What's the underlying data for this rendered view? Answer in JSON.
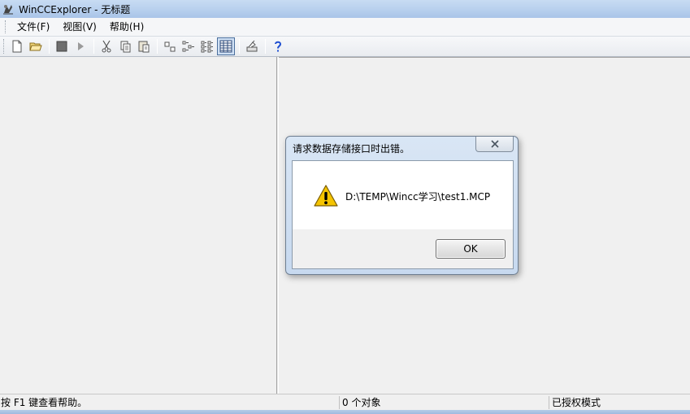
{
  "window": {
    "title": "WinCCExplorer - 无标题",
    "icon": "wincc-app-icon"
  },
  "menu": {
    "items": [
      {
        "label": "文件(F)"
      },
      {
        "label": "视图(V)"
      },
      {
        "label": "帮助(H)"
      }
    ]
  },
  "toolbar": {
    "buttons": [
      {
        "icon": "new-file-icon"
      },
      {
        "icon": "open-folder-icon"
      },
      {
        "icon": "stop-icon"
      },
      {
        "icon": "play-icon"
      },
      {
        "icon": "cut-icon"
      },
      {
        "icon": "copy-icon"
      },
      {
        "icon": "paste-icon"
      },
      {
        "icon": "large-icons-view-icon"
      },
      {
        "icon": "small-icons-view-icon"
      },
      {
        "icon": "list-view-icon"
      },
      {
        "icon": "details-view-icon"
      },
      {
        "icon": "properties-icon"
      },
      {
        "icon": "help-icon"
      }
    ],
    "active_button": "details-view-icon"
  },
  "statusbar": {
    "help_text": "按 F1 键查看帮助。",
    "object_count": "0 个对象",
    "mode": "已授权模式"
  },
  "dialog": {
    "title": "请求数据存储接口时出错。",
    "message": "D:\\TEMP\\Wincc学习\\test1.MCP",
    "ok_label": "OK",
    "icon": "warning-icon",
    "close_icon": "close-icon"
  },
  "colors": {
    "titlebar": "#b9d1ee",
    "dialog_frame": "#c7d9ef",
    "warning_yellow": "#f5c400",
    "help_blue": "#1f4fd1"
  }
}
